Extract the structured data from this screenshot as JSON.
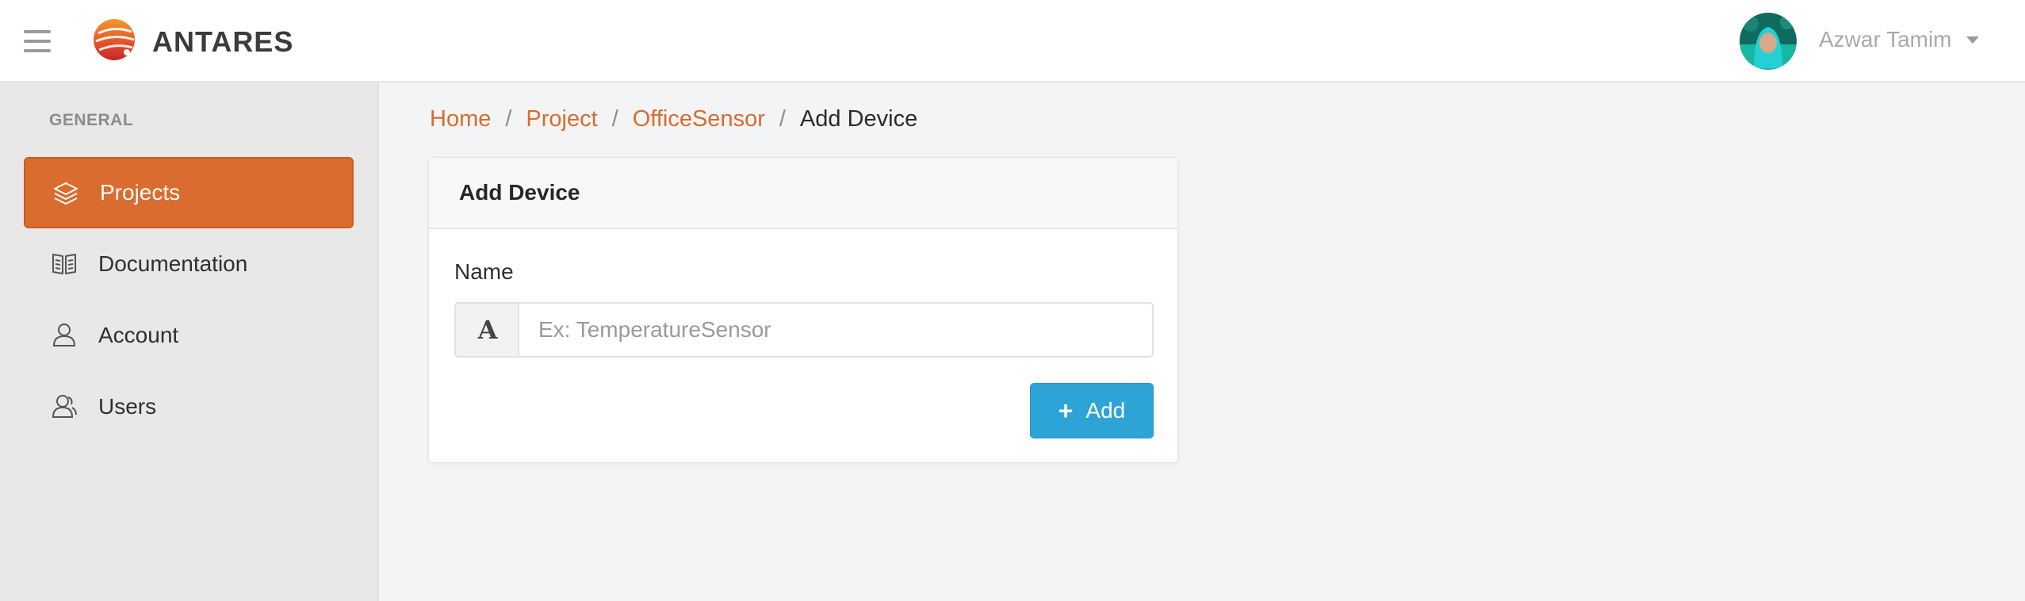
{
  "header": {
    "brand": "ANTARES",
    "user_name": "Azwar Tamim"
  },
  "sidebar": {
    "heading": "GENERAL",
    "items": [
      {
        "label": "Projects",
        "icon": "layers-icon",
        "active": true
      },
      {
        "label": "Documentation",
        "icon": "book-icon",
        "active": false
      },
      {
        "label": "Account",
        "icon": "user-icon",
        "active": false
      },
      {
        "label": "Users",
        "icon": "users-icon",
        "active": false
      }
    ]
  },
  "breadcrumb": {
    "items": [
      "Home",
      "Project",
      "OfficeSensor"
    ],
    "current": "Add Device"
  },
  "form": {
    "title": "Add Device",
    "name_label": "Name",
    "name_addon": "A",
    "name_value": "",
    "name_placeholder": "Ex: TemperatureSensor",
    "submit_label": "Add",
    "submit_icon": "+"
  },
  "colors": {
    "accent": "#d96c2e",
    "button": "#2ea4d6",
    "sidebar_bg": "#e8e8e8",
    "page_bg": "#f3f4f6"
  }
}
